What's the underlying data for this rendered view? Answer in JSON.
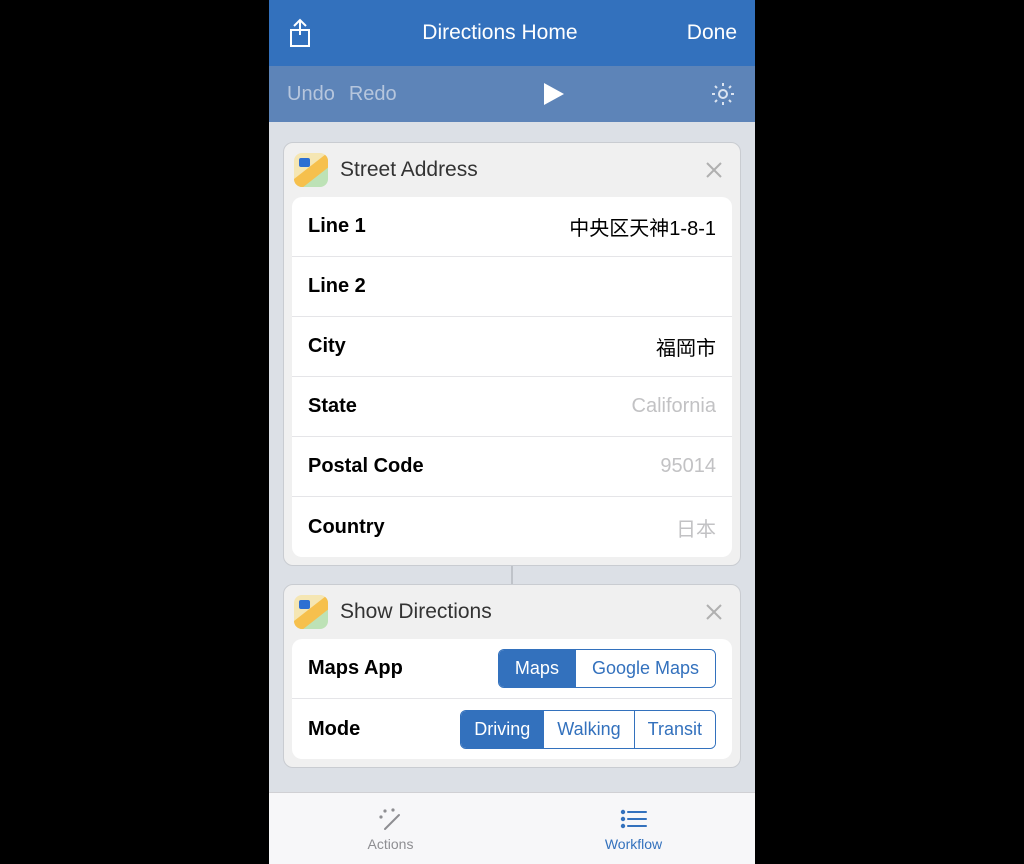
{
  "navbar": {
    "title": "Directions Home",
    "done": "Done"
  },
  "toolbar": {
    "undo": "Undo",
    "redo": "Redo"
  },
  "street_address_card": {
    "title": "Street Address",
    "rows": {
      "line1": {
        "label": "Line 1",
        "value": "中央区天神1-8-1"
      },
      "line2": {
        "label": "Line 2",
        "value": ""
      },
      "city": {
        "label": "City",
        "value": "福岡市"
      },
      "state": {
        "label": "State",
        "placeholder": "California"
      },
      "postal": {
        "label": "Postal Code",
        "placeholder": "95014"
      },
      "country": {
        "label": "Country",
        "placeholder": "日本"
      }
    }
  },
  "show_directions_card": {
    "title": "Show Directions",
    "maps_app": {
      "label": "Maps App",
      "options": [
        "Maps",
        "Google Maps"
      ],
      "selected": "Maps"
    },
    "mode": {
      "label": "Mode",
      "options": [
        "Driving",
        "Walking",
        "Transit"
      ],
      "selected": "Driving"
    }
  },
  "tabs": {
    "actions": "Actions",
    "workflow": "Workflow"
  }
}
